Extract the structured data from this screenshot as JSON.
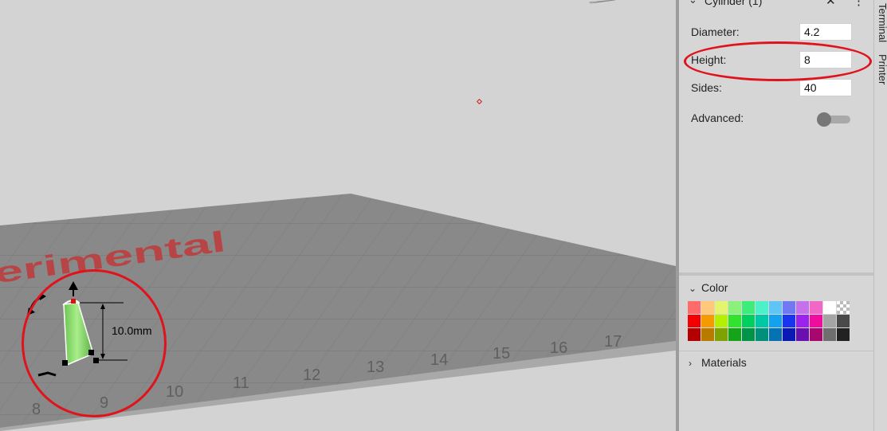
{
  "viewport": {
    "bed_watermark": "erimental",
    "grid_numbers": [
      "8",
      "9",
      "10",
      "11",
      "12",
      "13",
      "14",
      "15",
      "16",
      "17"
    ],
    "dimension_label": "10.0mm"
  },
  "panel": {
    "object_title": "Cylinder (1)",
    "close_icon": "close-icon",
    "menu_icon": "more-vertical-icon",
    "fields": {
      "diameter": {
        "label": "Diameter:",
        "value": "4.2"
      },
      "height": {
        "label": "Height:",
        "value": "8"
      },
      "sides": {
        "label": "Sides:",
        "value": "40"
      },
      "advanced": {
        "label": "Advanced:"
      }
    },
    "color_section": {
      "label": "Color",
      "swatches": [
        "#ff6b6b",
        "#ffc87a",
        "#e4f56d",
        "#8cf07c",
        "#3ded7a",
        "#4df0c8",
        "#5fc5f5",
        "#7179f2",
        "#c571ec",
        "#f067c6",
        "#ffffff",
        "checker",
        "#f50000",
        "#f59a00",
        "#b4f000",
        "#33e22e",
        "#00d15e",
        "#00c8a6",
        "#12a2f0",
        "#1b34f0",
        "#9c22f0",
        "#f00c9c",
        "#a5a5a5",
        "#4a4a4a",
        "#b30000",
        "#b97a00",
        "#7ea300",
        "#16a31a",
        "#009448",
        "#008f7a",
        "#0772b3",
        "#0a1ab3",
        "#6a0fb0",
        "#a8086e",
        "#6f6f6f",
        "#222222"
      ]
    },
    "materials_section": {
      "label": "Materials"
    }
  },
  "side_tabs": [
    "Terminal",
    "Printer"
  ],
  "colors": {
    "annotation": "#e0131d",
    "bed": "#8a8a8a",
    "watermark": "#c13a3a",
    "model": "#86d86a"
  }
}
